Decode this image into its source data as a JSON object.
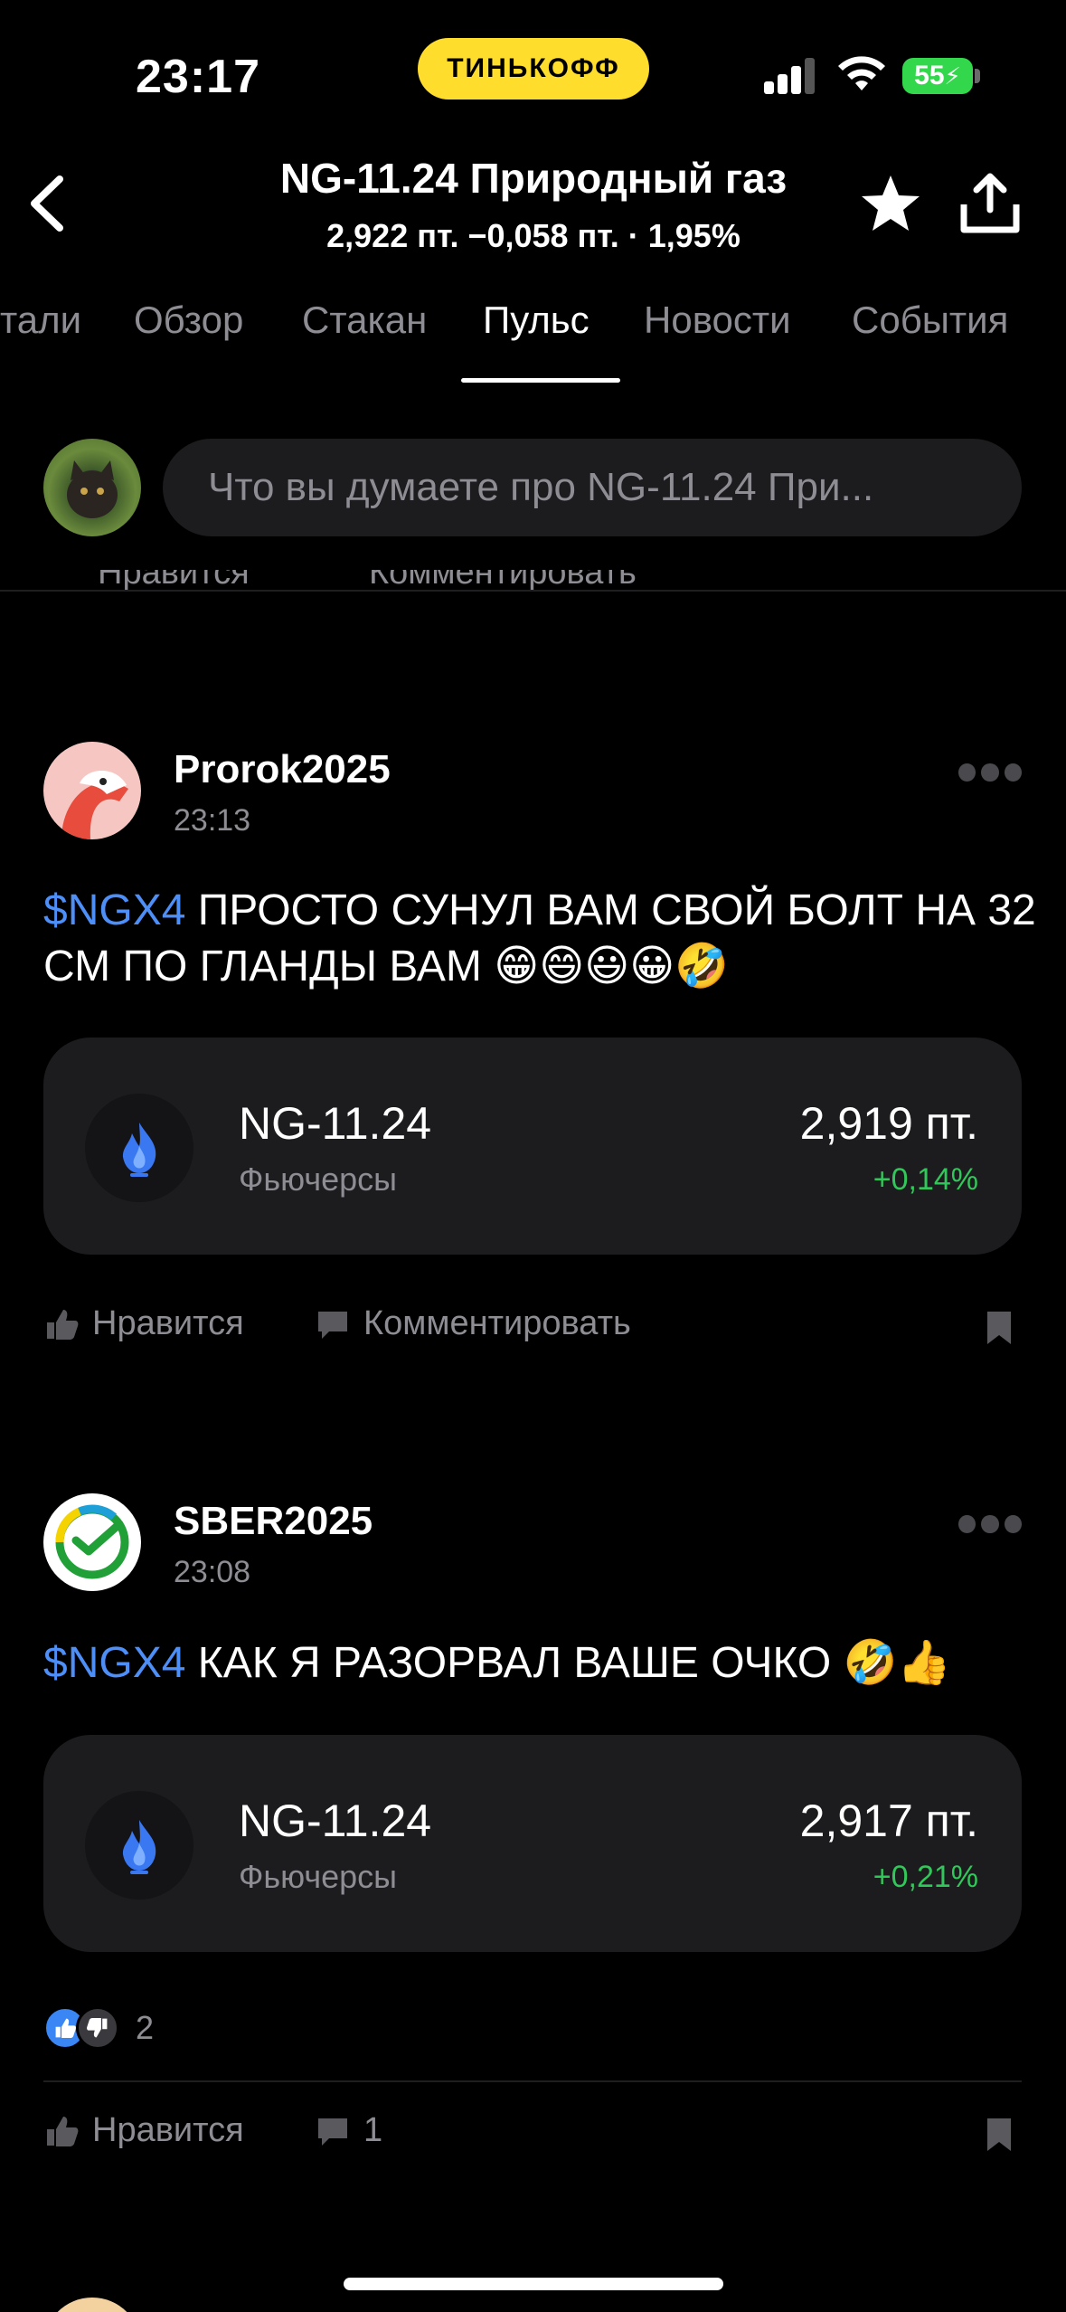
{
  "status_bar": {
    "time": "23:17",
    "brand": "ТИНЬКОФФ",
    "battery": "55"
  },
  "header": {
    "title": "NG-11.24 Природный газ",
    "subtitle": "2,922 пт.  −0,058 пт. · 1,95%"
  },
  "tabs": [
    {
      "label": "тали",
      "active": false
    },
    {
      "label": "Обзор",
      "active": false
    },
    {
      "label": "Стакан",
      "active": false
    },
    {
      "label": "Пульс",
      "active": true
    },
    {
      "label": "Новости",
      "active": false
    },
    {
      "label": "События",
      "active": false
    }
  ],
  "composer": {
    "placeholder": "Что вы думаете про NG-11.24 При..."
  },
  "prev_post_actions": {
    "like_label": "Нравится",
    "comment_label": "Комментировать"
  },
  "posts": [
    {
      "author": "Prorok2025",
      "time": "23:13",
      "ticker": "$NGX4",
      "text": " ПРОСТО СУНУЛ ВАМ СВОЙ БОЛТ НА 32 СМ ПО ГЛАНДЫ ВАМ 😁😄😃😀🤣",
      "instrument": {
        "name": "NG-11.24",
        "type": "Фьючерсы",
        "price": "2,919 пт.",
        "change": "+0,14%"
      },
      "like_label": "Нравится",
      "comment_label": "Комментировать"
    },
    {
      "author": "SBER2025",
      "time": "23:08",
      "ticker": "$NGX4",
      "text": " КАК Я РАЗОРВАЛ ВАШЕ ОЧКО 🤣👍",
      "instrument": {
        "name": "NG-11.24",
        "type": "Фьючерсы",
        "price": "2,917 пт.",
        "change": "+0,21%"
      },
      "reactions_count": "2",
      "like_label": "Нравится",
      "comment_count": "1"
    }
  ],
  "colors": {
    "accent": "#ffdd2d",
    "ticker": "#4d8ef7",
    "positive": "#32c75a",
    "muted": "#8d8d93",
    "card": "#1c1c1e"
  }
}
